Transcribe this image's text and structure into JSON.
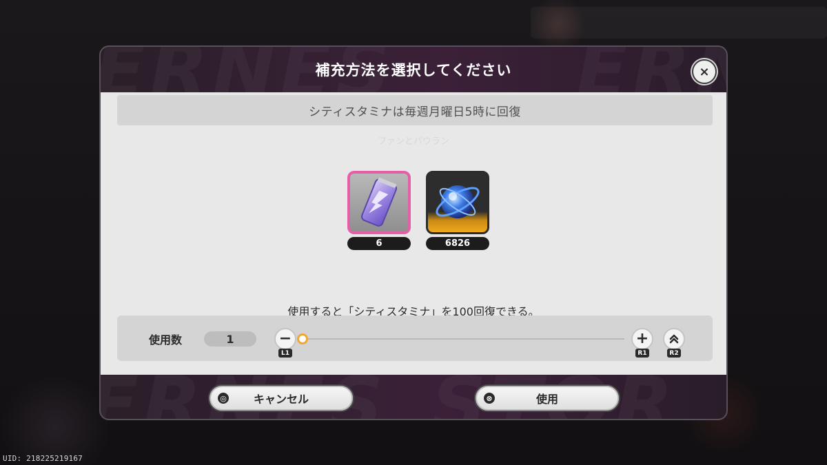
{
  "dialog": {
    "title": "補充方法を選択してください",
    "close_icon": "×"
  },
  "notice": "シティスタミナは毎週月曜日5時に回復",
  "faint_label": "ファンとパウラン",
  "items": [
    {
      "name": "energy-drink",
      "count": "6",
      "selected": true,
      "border_color": "#e55fa6"
    },
    {
      "name": "polychrome-orb",
      "count": "6826",
      "selected": false,
      "border_color": "#f0a91c"
    }
  ],
  "description": "使用すると「シティスタミナ」を100回復できる。",
  "usage": {
    "label": "使用数",
    "quantity": "1",
    "minus": "−",
    "plus": "+",
    "max": "⌃⌃",
    "l1": "L1",
    "r1": "R1",
    "r2": "R2",
    "slider_fraction": 0
  },
  "buttons": {
    "cancel_label": "キャンセル",
    "cancel_icon": "◎",
    "use_label": "使用",
    "use_icon": "⊗"
  },
  "uid": "UID: 218225219167",
  "colors": {
    "accent_pink": "#e55fa6",
    "accent_gold": "#f0a91c",
    "slider_knob": "#f0a834"
  }
}
